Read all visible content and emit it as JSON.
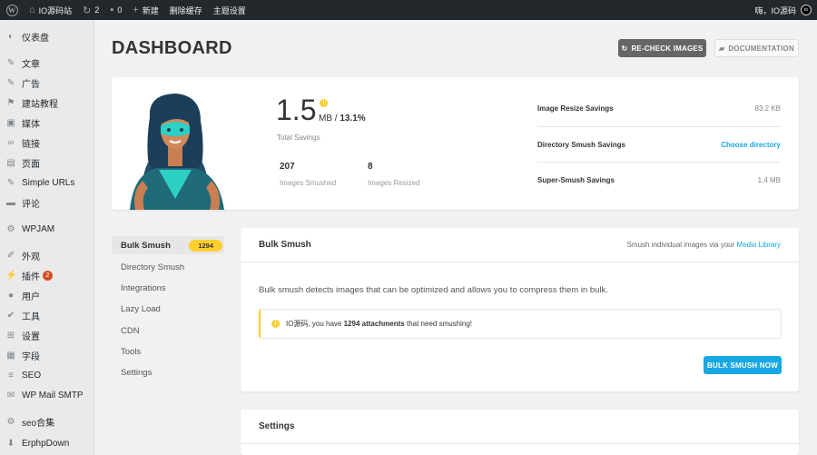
{
  "adminbar": {
    "site_name": "IO源码站",
    "updates_count": "2",
    "comments_count": "0",
    "new_label": "新建",
    "clear_cache_label": "删除缓存",
    "theme_settings_label": "主题设置",
    "greeting": "嗨，IO源码"
  },
  "sidebar": {
    "items": [
      {
        "label": "仪表盘",
        "icon": "dashboard-icon"
      },
      {
        "label": "文章",
        "icon": "pin-icon"
      },
      {
        "label": "广告",
        "icon": "pin-icon"
      },
      {
        "label": "建站教程",
        "icon": "flag-icon"
      },
      {
        "label": "媒体",
        "icon": "media-icon"
      },
      {
        "label": "链接",
        "icon": "link-icon"
      },
      {
        "label": "页面",
        "icon": "page-icon"
      },
      {
        "label": "Simple URLs",
        "icon": "pin-icon"
      },
      {
        "label": "评论",
        "icon": "comment-icon"
      },
      {
        "label": "WPJAM",
        "icon": "gear-icon"
      },
      {
        "label": "外观",
        "icon": "brush-icon"
      },
      {
        "label": "插件",
        "icon": "plugin-icon",
        "badge": "2"
      },
      {
        "label": "用户",
        "icon": "user-icon"
      },
      {
        "label": "工具",
        "icon": "wrench-icon"
      },
      {
        "label": "设置",
        "icon": "settings-icon"
      },
      {
        "label": "字段",
        "icon": "fields-icon"
      },
      {
        "label": "SEO",
        "icon": "seo-icon"
      },
      {
        "label": "WP Mail SMTP",
        "icon": "mail-icon"
      },
      {
        "label": "seo合集",
        "icon": "gear-icon"
      },
      {
        "label": "ErphpDown",
        "icon": "download-icon"
      }
    ]
  },
  "header": {
    "title": "DASHBOARD",
    "recheck_label": "RE-CHECK IMAGES",
    "docs_label": "DOCUMENTATION"
  },
  "summary": {
    "total_value": "1.5",
    "total_unit": "MB",
    "total_pct": "13.1%",
    "total_label": "Total Savings",
    "smushed_count": "207",
    "smushed_label": "Images Smushed",
    "resized_count": "8",
    "resized_label": "Images Resized",
    "rows": [
      {
        "label": "Image Resize Savings",
        "value": "83.2 KB"
      },
      {
        "label": "Directory Smush Savings",
        "value": "Choose directory"
      },
      {
        "label": "Super-Smush Savings",
        "value": "1.4 MB"
      }
    ]
  },
  "subnav": {
    "items": [
      "Bulk Smush",
      "Directory Smush",
      "Integrations",
      "Lazy Load",
      "CDN",
      "Tools",
      "Settings"
    ],
    "active_count": "1294"
  },
  "bulk": {
    "title": "Bulk Smush",
    "hint_prefix": "Smush individual images via your",
    "hint_link": "Media Library",
    "description": "Bulk smush detects images that can be optimized and allows you to compress them in bulk.",
    "notice_prefix": "IO源码, you have",
    "notice_bold": "1294 attachments",
    "notice_suffix": "that need smushing!",
    "button_label": "BULK SMUSH NOW"
  },
  "settings_card": {
    "title": "Settings"
  },
  "colors": {
    "accent": "#17a8e3",
    "warning": "#fecf2f",
    "adminbar": "#23282d"
  }
}
